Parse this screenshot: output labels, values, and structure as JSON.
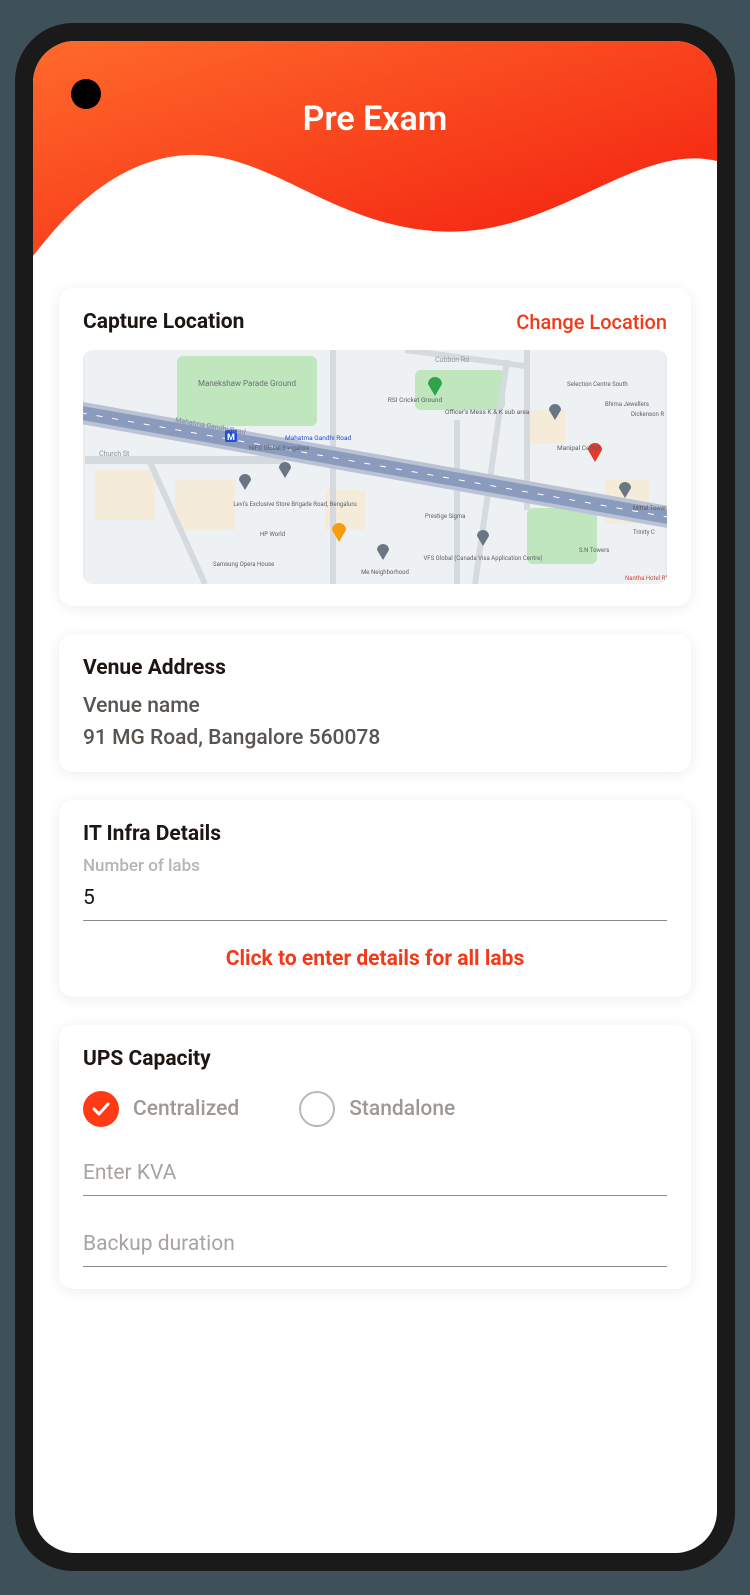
{
  "header": {
    "title": "Pre Exam"
  },
  "location": {
    "title": "Capture Location",
    "change_link": "Change Location"
  },
  "venue": {
    "title": "Venue Address",
    "name": "Venue name",
    "address": "91 MG Road, Bangalore 560078"
  },
  "it_infra": {
    "title": "IT Infra Details",
    "labs_label": "Number of labs",
    "labs_value": "5",
    "cta": "Click to enter details for all labs"
  },
  "ups": {
    "title": "UPS Capacity",
    "opt_centralized": "Centralized",
    "opt_standalone": "Standalone",
    "kva_placeholder": "Enter KVA",
    "backup_placeholder": "Backup duration"
  },
  "map_labels": {
    "parade": "Manekshaw Parade Ground",
    "road1": "Mahatma Gandhi Road",
    "road2": "Cubbon Rd",
    "church": "Church St",
    "mess": "Officer's Mess K & K sub area",
    "cricket": "RSI Cricket Ground",
    "levis": "Levi's Exclusive Store Brigade Road, Bengaluru",
    "hp": "HP World",
    "opera": "Samsung Opera House",
    "vfs": "VFS Global (Canada Visa Application Centre)",
    "manipal": "Manipal Center",
    "selection": "Selection Centre South",
    "bhima": "Bhima Jewellers",
    "dickenson": "Dickenson R",
    "mittal": "Mittal Tower",
    "sntowers": "S.N Towers",
    "trinity": "Trinity C",
    "prestige": "Prestige Sigma",
    "neighborhood": "Me Neighborhood",
    "nifd": "NIFD Global Bangalore",
    "mgmetro": "Mahatma Gandhi Road",
    "nantha": "Nantha Hotel Rf"
  }
}
